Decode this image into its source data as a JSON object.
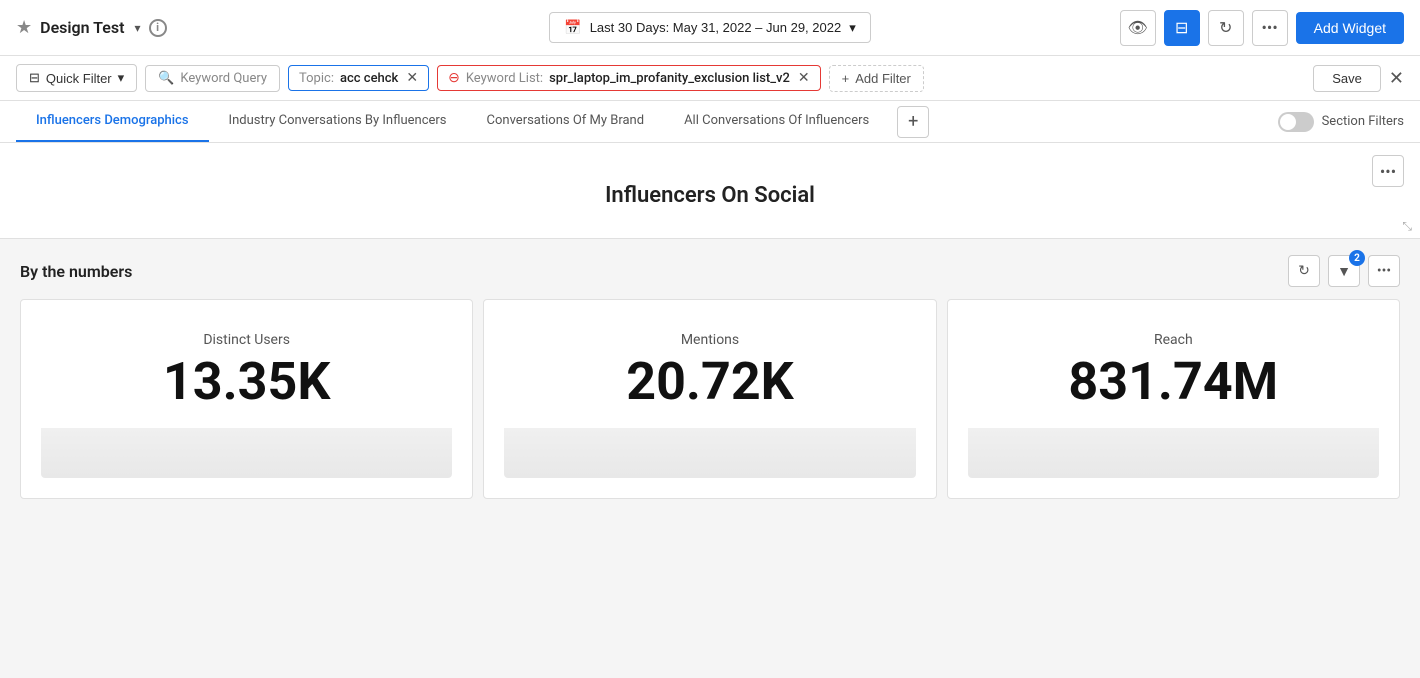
{
  "header": {
    "star_icon": "★",
    "app_title": "Design Test",
    "chevron_icon": "▾",
    "info_icon": "i",
    "date_range": "Last 30 Days: May 31, 2022 – Jun 29, 2022",
    "eye_icon": "👁",
    "filter_icon": "⊟",
    "refresh_icon": "↻",
    "more_icon": "•••",
    "add_widget_label": "Add Widget"
  },
  "filter_bar": {
    "quick_filter_label": "Quick Filter",
    "quick_filter_chevron": "▾",
    "keyword_query_label": "Keyword Query",
    "topic_label": "Topic:",
    "topic_value": "acc cehck",
    "keyword_list_label": "Keyword List:",
    "keyword_list_value": "spr_laptop_im_profanity_exclusion list_v2",
    "add_filter_label": "Add Filter",
    "save_label": "Save",
    "close_icon": "✕"
  },
  "tabs": [
    {
      "id": "influencers-demographics",
      "label": "Influencers Demographics",
      "active": true
    },
    {
      "id": "industry-conversations",
      "label": "Industry Conversations By Influencers",
      "active": false
    },
    {
      "id": "conversations-brand",
      "label": "Conversations Of My Brand",
      "active": false
    },
    {
      "id": "all-conversations",
      "label": "All Conversations Of Influencers",
      "active": false
    }
  ],
  "tab_add_icon": "+",
  "section_filters_label": "Section Filters",
  "widget": {
    "title": "Influencers On Social",
    "more_icon": "•••",
    "resize_icon": "⤡"
  },
  "by_numbers": {
    "title": "By the numbers",
    "refresh_icon": "↻",
    "filter_icon": "▼",
    "filter_badge": "2",
    "more_icon": "•••"
  },
  "stat_cards": [
    {
      "label": "Distinct Users",
      "value": "13.35K"
    },
    {
      "label": "Mentions",
      "value": "20.72K"
    },
    {
      "label": "Reach",
      "value": "831.74M"
    }
  ]
}
